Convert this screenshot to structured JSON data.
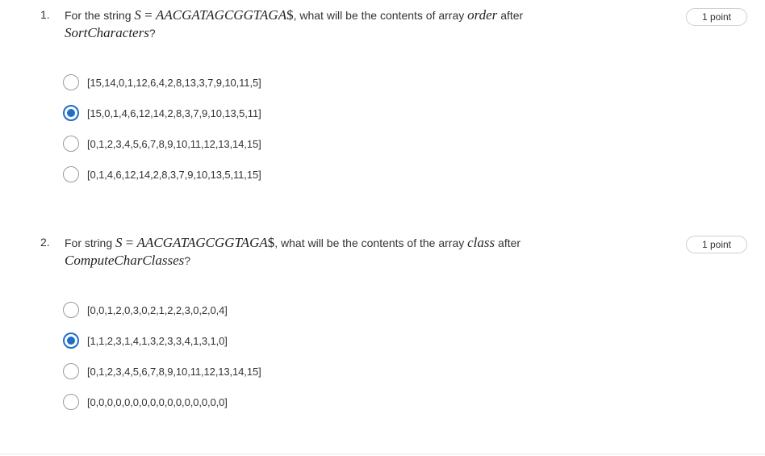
{
  "questions": [
    {
      "number": "1.",
      "text_prefix": "For the string ",
      "math_eq_lhs": "S",
      "math_eq_sign": " = ",
      "math_eq_rhs": "AACGATAGCGGTAGA",
      "math_dollar": "$",
      "text_middle": ", what will be the contents of array ",
      "math_var": "order",
      "text_after": " after",
      "math_func": "SortCharacters",
      "text_end": "?",
      "points": "1 point",
      "options": [
        {
          "label": "[15,14,0,1,12,6,4,2,8,13,3,7,9,10,11,5]",
          "selected": false
        },
        {
          "label": "[15,0,1,4,6,12,14,2,8,3,7,9,10,13,5,11]",
          "selected": true
        },
        {
          "label": "[0,1,2,3,4,5,6,7,8,9,10,11,12,13,14,15]",
          "selected": false
        },
        {
          "label": "[0,1,4,6,12,14,2,8,3,7,9,10,13,5,11,15]",
          "selected": false
        }
      ]
    },
    {
      "number": "2.",
      "text_prefix": "For string ",
      "math_eq_lhs": "S",
      "math_eq_sign": " = ",
      "math_eq_rhs": "AACGATAGCGGTAGA",
      "math_dollar": "$",
      "text_middle": ", what will be the contents of the array ",
      "math_var": "class",
      "text_after": " after",
      "math_func": "ComputeCharClasses",
      "text_end": "?",
      "points": "1 point",
      "options": [
        {
          "label": "[0,0,1,2,0,3,0,2,1,2,2,3,0,2,0,4]",
          "selected": false
        },
        {
          "label": "[1,1,2,3,1,4,1,3,2,3,3,4,1,3,1,0]",
          "selected": true
        },
        {
          "label": "[0,1,2,3,4,5,6,7,8,9,10,11,12,13,14,15]",
          "selected": false
        },
        {
          "label": "[0,0,0,0,0,0,0,0,0,0,0,0,0,0,0,0]",
          "selected": false
        }
      ]
    }
  ],
  "colors": {
    "accent": "#1f6ec9",
    "text": "#333333",
    "border": "#cfcfcf"
  }
}
